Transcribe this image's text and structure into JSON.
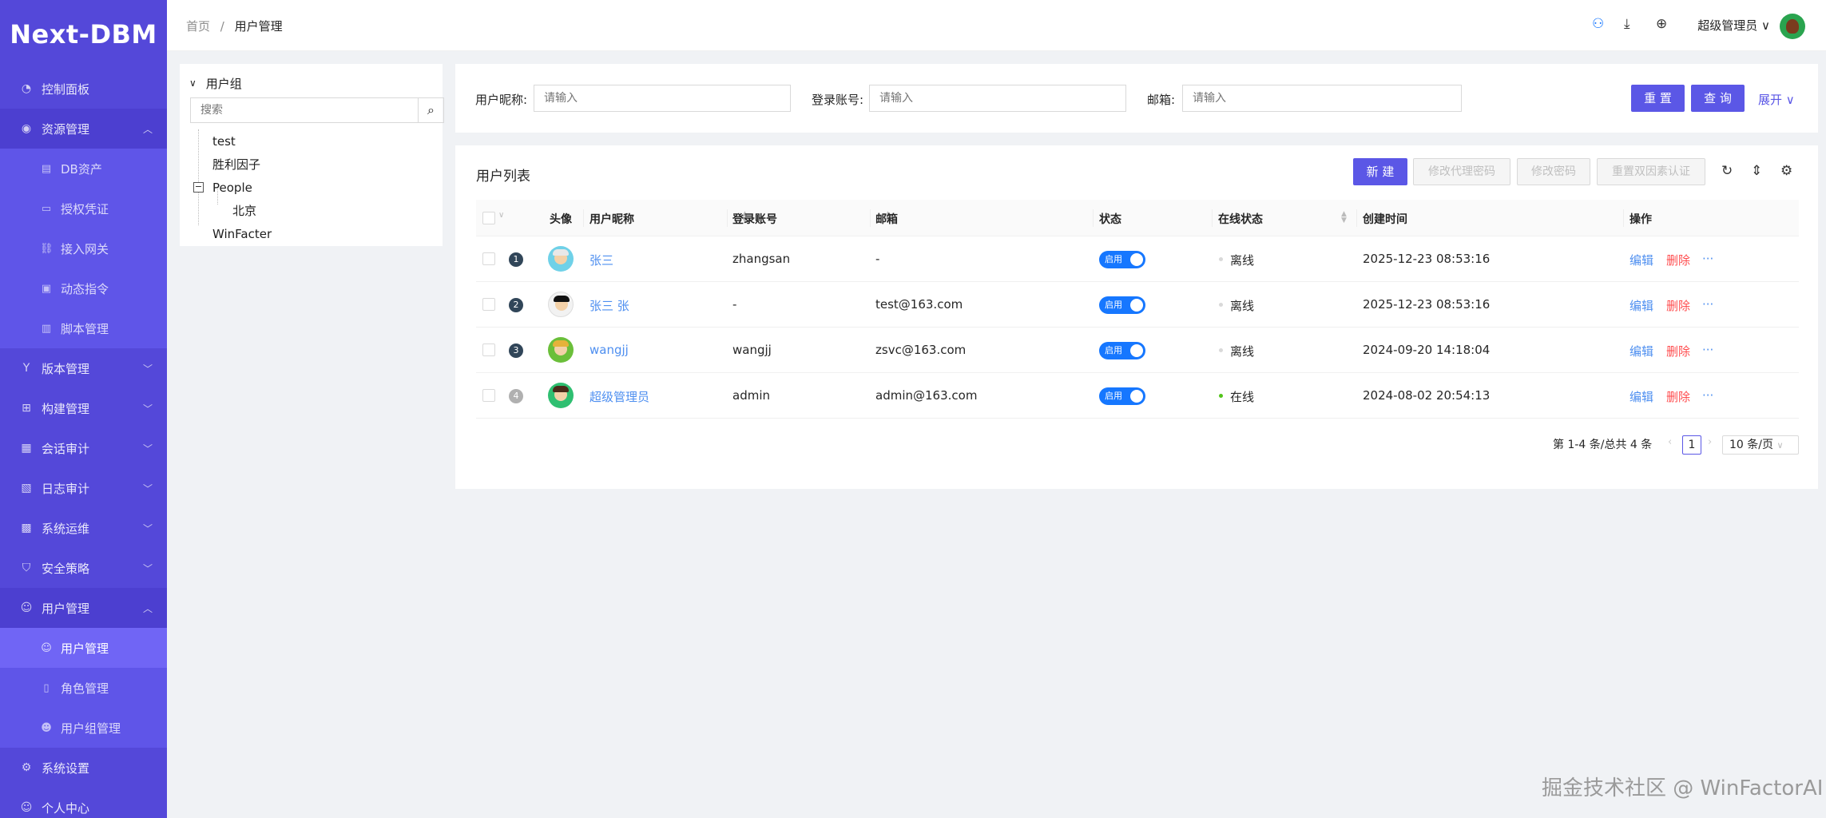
{
  "app": {
    "name": "Next-DBM"
  },
  "sidebar": {
    "items": [
      {
        "label": "控制面板",
        "icon": "dashboard-icon"
      },
      {
        "label": "资源管理",
        "icon": "eye-icon",
        "expanded": true,
        "children": [
          {
            "label": "DB资产",
            "icon": "database-icon"
          },
          {
            "label": "授权凭证",
            "icon": "credential-icon"
          },
          {
            "label": "接入网关",
            "icon": "link-icon"
          },
          {
            "label": "动态指令",
            "icon": "terminal-icon"
          },
          {
            "label": "脚本管理",
            "icon": "script-icon"
          }
        ]
      },
      {
        "label": "版本管理",
        "icon": "branch-icon",
        "expanded": false
      },
      {
        "label": "构建管理",
        "icon": "build-icon",
        "expanded": false
      },
      {
        "label": "会话审计",
        "icon": "audit-icon",
        "expanded": false
      },
      {
        "label": "日志审计",
        "icon": "log-icon",
        "expanded": false
      },
      {
        "label": "系统运维",
        "icon": "ops-icon",
        "expanded": false
      },
      {
        "label": "安全策略",
        "icon": "shield-icon",
        "expanded": false
      },
      {
        "label": "用户管理",
        "icon": "user-icon",
        "expanded": true,
        "children": [
          {
            "label": "用户管理",
            "icon": "user-icon",
            "active": true
          },
          {
            "label": "角色管理",
            "icon": "role-icon"
          },
          {
            "label": "用户组管理",
            "icon": "group-icon"
          }
        ]
      },
      {
        "label": "系统设置",
        "icon": "gear-icon"
      },
      {
        "label": "个人中心",
        "icon": "user-icon"
      }
    ]
  },
  "header": {
    "breadcrumb": [
      "首页",
      "/",
      "用户管理"
    ],
    "username": "超级管理员",
    "icons": [
      "network-icon",
      "download-icon",
      "globe-icon"
    ]
  },
  "tree": {
    "root": "用户组",
    "search_placeholder": "搜索",
    "nodes": [
      "test",
      "胜利因子",
      "People",
      "北京",
      "WinFacter"
    ]
  },
  "search_form": {
    "nickname_label": "用户昵称:",
    "account_label": "登录账号:",
    "email_label": "邮箱:",
    "placeholder": "请输入",
    "reset": "重 置",
    "query": "查 询",
    "expand": "展开"
  },
  "table": {
    "title": "用户列表",
    "buttons": {
      "new": "新 建",
      "change_proxy_pwd": "修改代理密码",
      "change_pwd": "修改密码",
      "reset_2fa": "重置双因素认证"
    },
    "columns": [
      "头像",
      "用户昵称",
      "登录账号",
      "邮箱",
      "状态",
      "在线状态",
      "创建时间",
      "操作"
    ],
    "rows": [
      {
        "index": "1",
        "nickname": "张三",
        "account": "zhangsan",
        "email": "-",
        "status": "启用",
        "online": "离线",
        "online_on": false,
        "created": "2025-12-23 08:53:16"
      },
      {
        "index": "2",
        "nickname": "张三 张",
        "account": "-",
        "email": "test@163.com",
        "status": "启用",
        "online": "离线",
        "online_on": false,
        "created": "2025-12-23 08:53:16"
      },
      {
        "index": "3",
        "nickname": "wangjj",
        "account": "wangjj",
        "email": "zsvc@163.com",
        "status": "启用",
        "online": "离线",
        "online_on": false,
        "created": "2024-09-20 14:18:04"
      },
      {
        "index": "4",
        "nickname": "超级管理员",
        "account": "admin",
        "email": "admin@163.com",
        "status": "启用",
        "online": "在线",
        "online_on": true,
        "created": "2024-08-02 20:54:13"
      }
    ],
    "actions": {
      "edit": "编辑",
      "delete": "删除",
      "more": "···"
    },
    "pagination": {
      "summary": "第 1-4 条/总共 4 条",
      "current": "1",
      "page_size": "10 条/页"
    }
  },
  "watermark": "掘金技术社区 @ WinFactorAI",
  "colors": {
    "sidebar": "#5448d9",
    "primary": "#5b57e6",
    "link": "#4e8ff0",
    "danger": "#ff4d4f",
    "switch": "#1677ff"
  }
}
